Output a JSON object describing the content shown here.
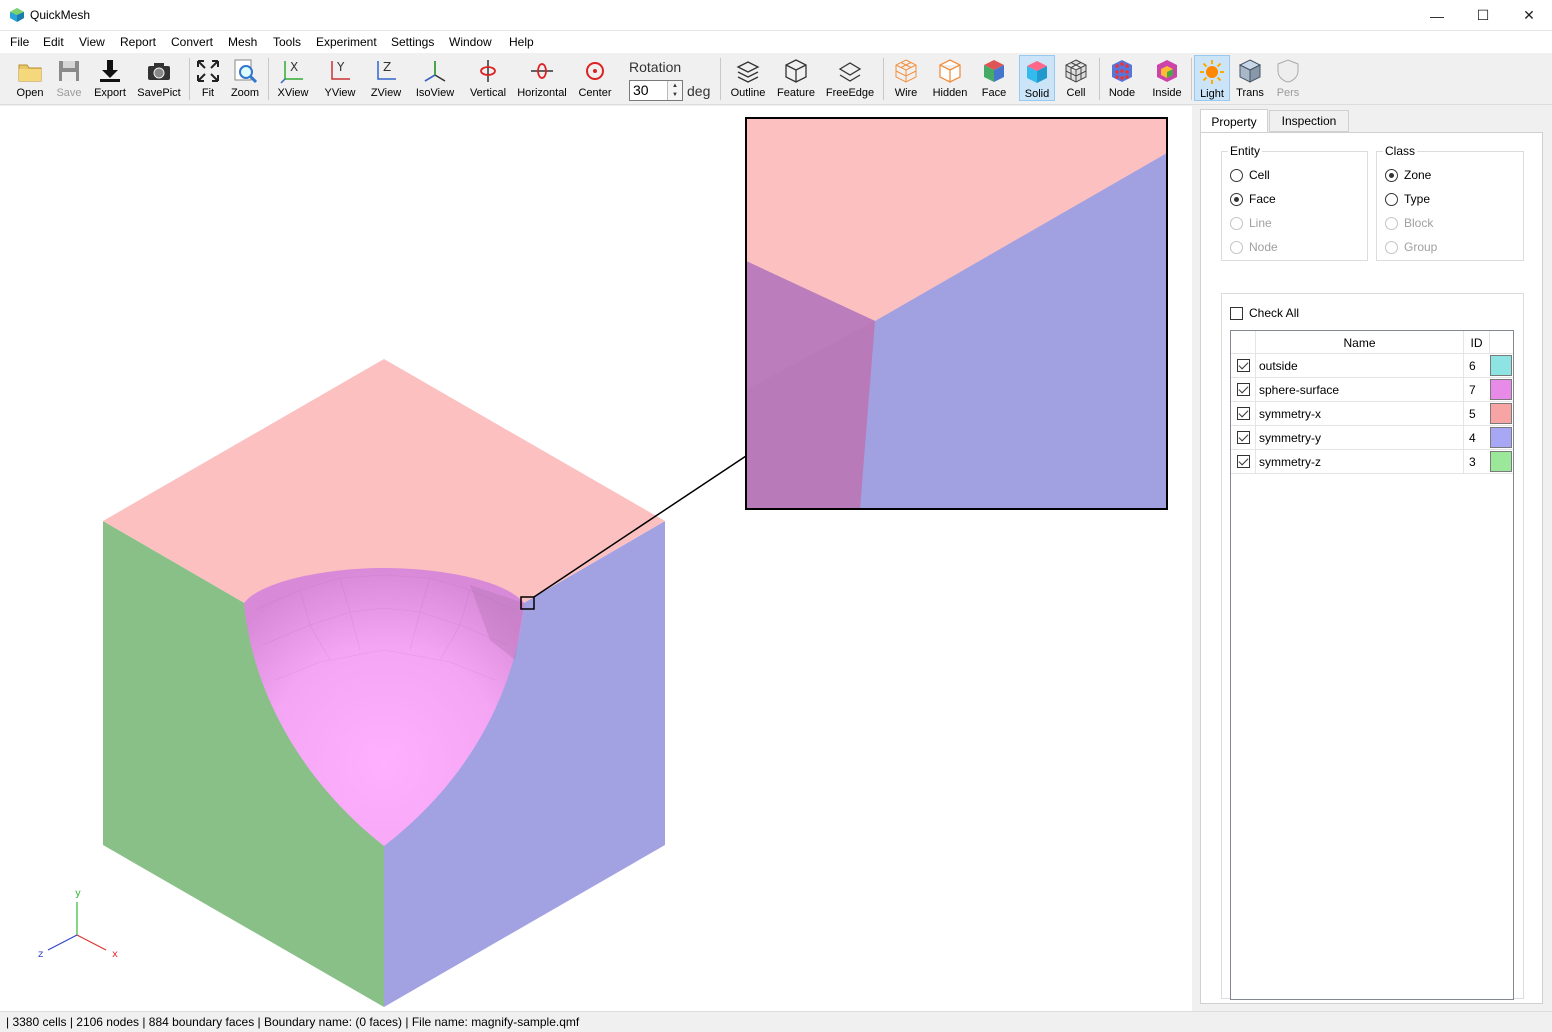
{
  "window": {
    "title": "QuickMesh",
    "minimize": "—",
    "maximize": "☐",
    "close": "✕"
  },
  "menu": [
    "File",
    "Edit",
    "View",
    "Report",
    "Convert",
    "Mesh",
    "Tools",
    "Experiment",
    "Settings",
    "Window",
    "Help"
  ],
  "toolbar": {
    "open": "Open",
    "save": "Save",
    "export": "Export",
    "savepict": "SavePict",
    "fit": "Fit",
    "zoom": "Zoom",
    "xview": "XView",
    "yview": "YView",
    "zview": "ZView",
    "isoview": "IsoView",
    "vertical": "Vertical",
    "horizontal": "Horizontal",
    "center": "Center",
    "rotation_label": "Rotation",
    "rotation_value": "30",
    "rotation_unit": "deg",
    "outline": "Outline",
    "feature": "Feature",
    "freeedge": "FreeEdge",
    "wire": "Wire",
    "hidden": "Hidden",
    "face": "Face",
    "solid": "Solid",
    "cell": "Cell",
    "node": "Node",
    "inside": "Inside",
    "light": "Light",
    "trans": "Trans",
    "pers": "Pers"
  },
  "axes": {
    "x": "x",
    "y": "y",
    "z": "z"
  },
  "panel": {
    "tabs": [
      "Property",
      "Inspection"
    ],
    "entity": {
      "title": "Entity",
      "options": [
        "Cell",
        "Face",
        "Line",
        "Node"
      ],
      "selected": "Face"
    },
    "class": {
      "title": "Class",
      "options": [
        "Zone",
        "Type",
        "Block",
        "Group"
      ],
      "selected": "Zone"
    },
    "check_all": "Check All",
    "columns": {
      "name": "Name",
      "id": "ID"
    },
    "rows": [
      {
        "name": "outside",
        "id": "6",
        "color": "#8ee3e3"
      },
      {
        "name": "sphere-surface",
        "id": "7",
        "color": "#e88be8"
      },
      {
        "name": "symmetry-x",
        "id": "5",
        "color": "#f6a4a4"
      },
      {
        "name": "symmetry-y",
        "id": "4",
        "color": "#a7a7f5"
      },
      {
        "name": "symmetry-z",
        "id": "3",
        "color": "#9be89b"
      }
    ]
  },
  "status": "| 3380 cells | 2106 nodes | 884 boundary faces |  Boundary name:  (0 faces) | File name: magnify-sample.qmf"
}
